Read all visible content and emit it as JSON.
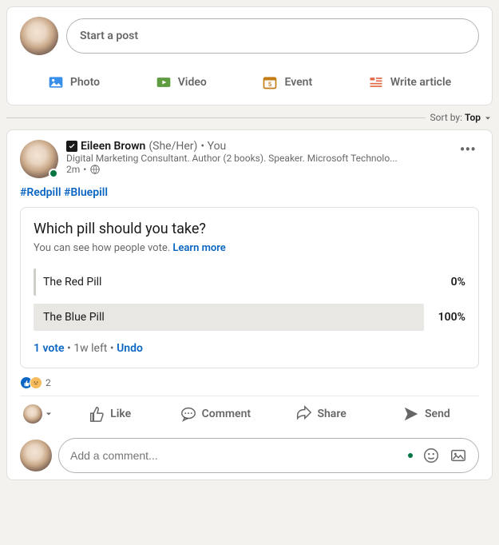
{
  "composer": {
    "placeholder": "Start a post",
    "actions": [
      {
        "label": "Photo",
        "icon": "photo-icon",
        "color": "#378fe9"
      },
      {
        "label": "Video",
        "icon": "video-icon",
        "color": "#5f9b41"
      },
      {
        "label": "Event",
        "icon": "event-icon",
        "color": "#c37d16"
      },
      {
        "label": "Write article",
        "icon": "article-icon",
        "color": "#e16745"
      }
    ]
  },
  "sort": {
    "prefix": "Sort by:",
    "value": "Top"
  },
  "post": {
    "author": {
      "name": "Eileen Brown",
      "pronoun": "(She/Her)",
      "relation": "• You",
      "headline": "Digital Marketing Consultant. Author (2 books). Speaker. Microsoft Technolo...",
      "time": "2m",
      "visibility": "Public"
    },
    "hashtags": [
      "#Redpill",
      "#Bluepill"
    ],
    "poll": {
      "question": "Which pill should you take?",
      "note_prefix": "You can see how people vote.",
      "note_link": "Learn more",
      "options": [
        {
          "label": "The Red Pill",
          "pct": "0%",
          "fill": 0
        },
        {
          "label": "The Blue Pill",
          "pct": "100%",
          "fill": 100
        }
      ],
      "footer": {
        "votes": "1 vote",
        "time_left": "1w left",
        "undo": "Undo"
      }
    },
    "reactions": {
      "count": "2"
    },
    "actions": {
      "like": "Like",
      "comment": "Comment",
      "share": "Share",
      "send": "Send"
    },
    "comment_placeholder": "Add a comment..."
  }
}
